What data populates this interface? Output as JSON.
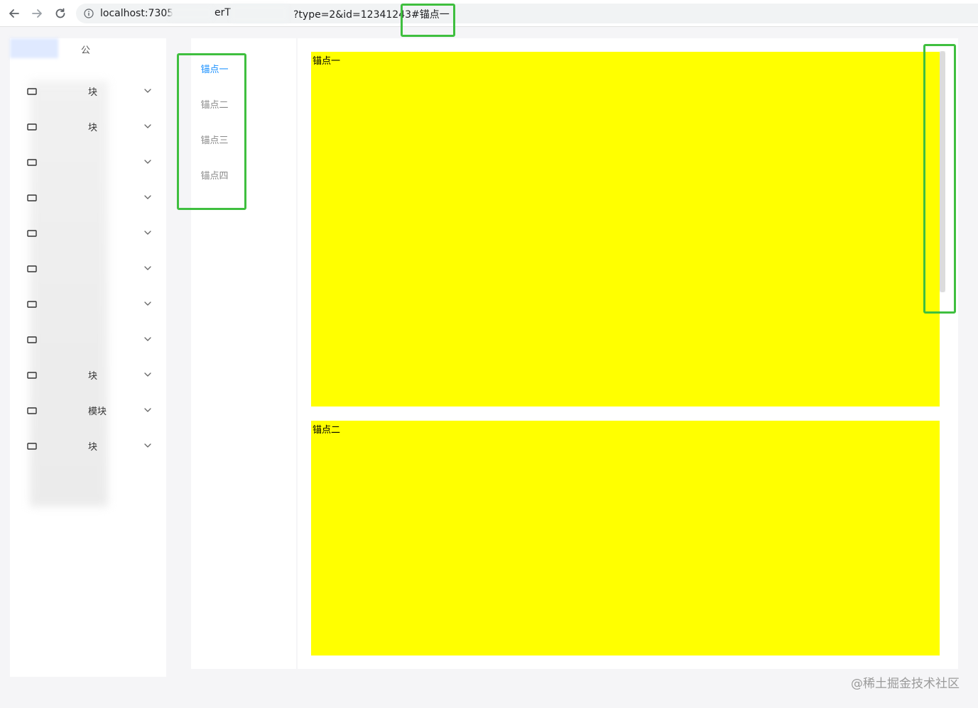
{
  "browser": {
    "url_host": "localhost:7305",
    "url_mid": "erT",
    "url_query": "?type=2&id=12341243",
    "url_hash": "#锚点一",
    "icons": [
      "back-arrow-icon",
      "forward-arrow-icon",
      "reload-icon",
      "info-icon"
    ]
  },
  "sidebar": {
    "top_item": "公",
    "items": [
      {
        "label": "块",
        "icon": "menu-item-icon"
      },
      {
        "label": "块",
        "icon": "menu-item-icon"
      },
      {
        "label": "",
        "icon": "menu-item-icon"
      },
      {
        "label": "",
        "icon": "menu-item-icon"
      },
      {
        "label": "",
        "icon": "menu-item-icon"
      },
      {
        "label": "",
        "icon": "menu-item-icon"
      },
      {
        "label": "",
        "icon": "menu-item-icon"
      },
      {
        "label": "",
        "icon": "menu-item-icon"
      },
      {
        "label": "块",
        "icon": "menu-item-icon"
      },
      {
        "label": "模块",
        "icon": "menu-item-icon"
      },
      {
        "label": "块",
        "icon": "menu-item-icon"
      }
    ]
  },
  "anchor_nav": {
    "links": [
      "锚点一",
      "锚点二",
      "锚点三",
      "锚点四"
    ],
    "active_index": 0,
    "active_color": "#1890ff",
    "inactive_color": "#8a8a8a"
  },
  "sections": [
    {
      "title": "锚点一",
      "color": "#ffff00"
    },
    {
      "title": "锚点二",
      "color": "#ffff00"
    }
  ],
  "highlight_color": "#3fbf3f",
  "watermark": "@稀土掘金技术社区"
}
